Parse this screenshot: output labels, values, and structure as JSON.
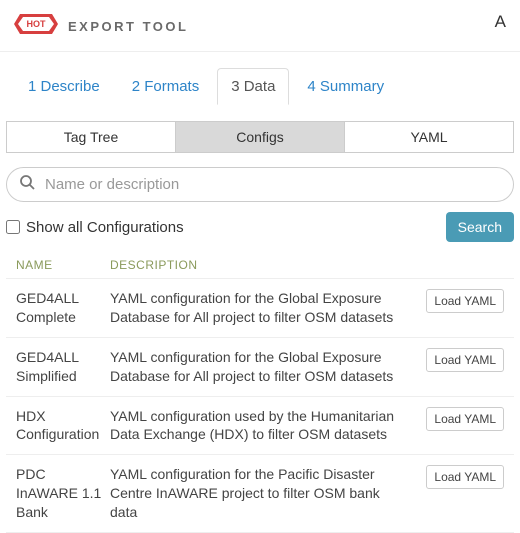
{
  "header": {
    "brand_tag": "HOT",
    "title": "EXPORT TOOL",
    "account": "A"
  },
  "tabs": [
    {
      "label": "1 Describe"
    },
    {
      "label": "2 Formats"
    },
    {
      "label": "3 Data",
      "active": true
    },
    {
      "label": "4 Summary"
    }
  ],
  "subtabs": [
    {
      "label": "Tag Tree"
    },
    {
      "label": "Configs",
      "active": true
    },
    {
      "label": "YAML"
    }
  ],
  "search": {
    "placeholder": "Name or description"
  },
  "showall": {
    "label": "Show all Configurations",
    "checked": false
  },
  "search_button": "Search",
  "columns": {
    "name": "NAME",
    "description": "DESCRIPTION"
  },
  "load_button_label": "Load YAML",
  "rows": [
    {
      "name": "GED4ALL Complete",
      "description": "YAML configuration for the Global Exposure Database for All project to filter OSM datasets"
    },
    {
      "name": "GED4ALL Simplified",
      "description": "YAML configuration for the Global Exposure Database for All project to filter OSM datasets"
    },
    {
      "name": "HDX Configuration",
      "description": "YAML configuration used by the Humanitarian Data Exchange (HDX) to filter OSM datasets"
    },
    {
      "name": "PDC InAWARE 1.1 Bank",
      "description": "YAML configuration for the Pacific Disaster Centre InAWARE project to filter OSM bank data"
    }
  ]
}
